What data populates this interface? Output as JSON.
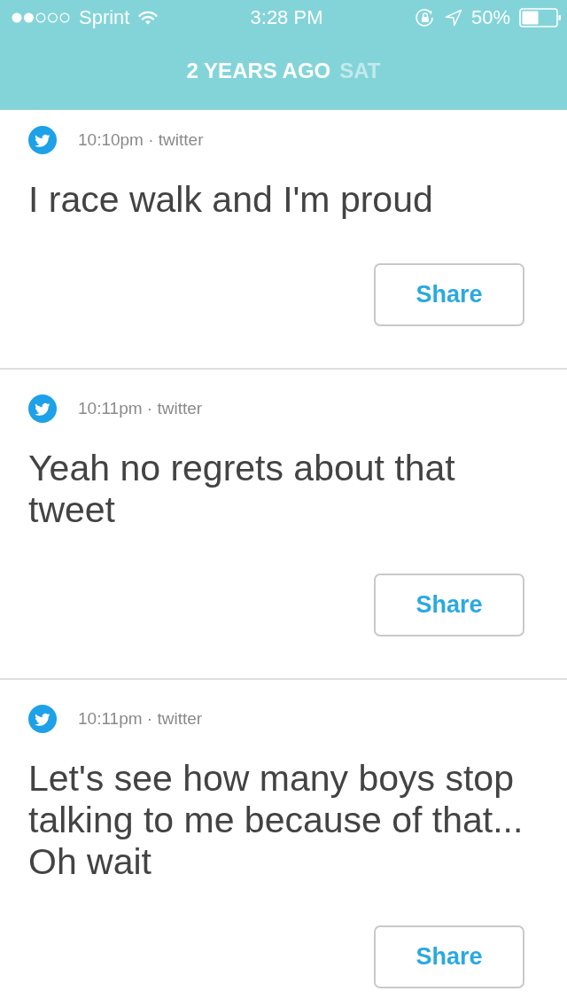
{
  "status_bar": {
    "carrier": "Sprint",
    "time": "3:28 PM",
    "battery": "50%"
  },
  "header": {
    "title": "2 YEARS AGO",
    "day": "SAT"
  },
  "posts": [
    {
      "meta": "10:10pm · twitter",
      "text": "I race walk and I'm proud",
      "button": "Share"
    },
    {
      "meta": "10:11pm · twitter",
      "text": "Yeah no regrets about that tweet",
      "button": "Share"
    },
    {
      "meta": "10:11pm · twitter",
      "text": "Let's see how many boys stop talking to me because of that... Oh wait",
      "button": "Share"
    }
  ]
}
